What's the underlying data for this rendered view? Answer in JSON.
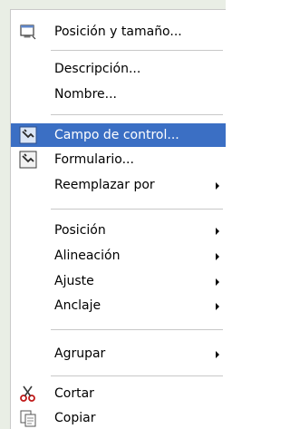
{
  "menu": {
    "items": [
      {
        "label": "Posición y tamaño...",
        "icon": "position-size-icon",
        "submenu": false
      },
      {
        "label": "Descripción...",
        "icon": "",
        "submenu": false
      },
      {
        "label": "Nombre...",
        "icon": "",
        "submenu": false
      },
      {
        "label": "Campo de control...",
        "icon": "control-field-icon",
        "submenu": false,
        "highlighted": true
      },
      {
        "label": "Formulario...",
        "icon": "form-icon",
        "submenu": false
      },
      {
        "label": "Reemplazar por",
        "icon": "",
        "submenu": true
      },
      {
        "label": "Posición",
        "icon": "",
        "submenu": true
      },
      {
        "label": "Alineación",
        "icon": "",
        "submenu": true
      },
      {
        "label": "Ajuste",
        "icon": "",
        "submenu": true
      },
      {
        "label": "Anclaje",
        "icon": "",
        "submenu": true
      },
      {
        "label": "Agrupar",
        "icon": "",
        "submenu": true
      },
      {
        "label": "Cortar",
        "icon": "scissors-icon",
        "submenu": false
      },
      {
        "label": "Copiar",
        "icon": "copy-icon",
        "submenu": false
      }
    ]
  },
  "colors": {
    "highlight": "#3b6fc4",
    "separator": "#c8c8c8",
    "text": "#000000",
    "highlight_text": "#ffffff"
  }
}
